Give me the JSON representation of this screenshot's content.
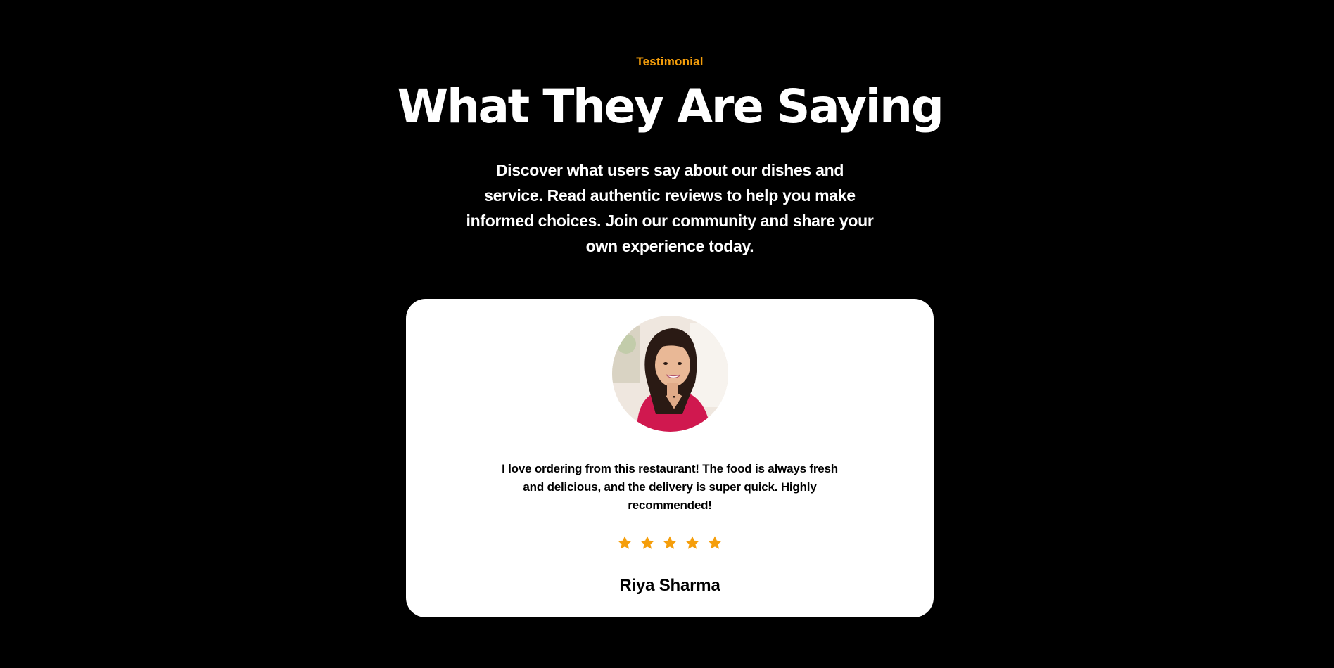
{
  "section": {
    "eyebrow": "Testimonial",
    "title": "What They Are Saying",
    "description": "Discover what users say about our dishes and service. Read authentic reviews to help you make informed choices. Join our community and share your own experience today."
  },
  "testimonial": {
    "avatar_icon": "customer-photo",
    "quote": "I love ordering from this restaurant! The food is always fresh and delicious, and the delivery is super quick. Highly recommended!",
    "rating": 5,
    "rating_max": 5,
    "author": "Riya Sharma"
  },
  "colors": {
    "background": "#000000",
    "accent": "#f59e0b",
    "card": "#ffffff"
  }
}
